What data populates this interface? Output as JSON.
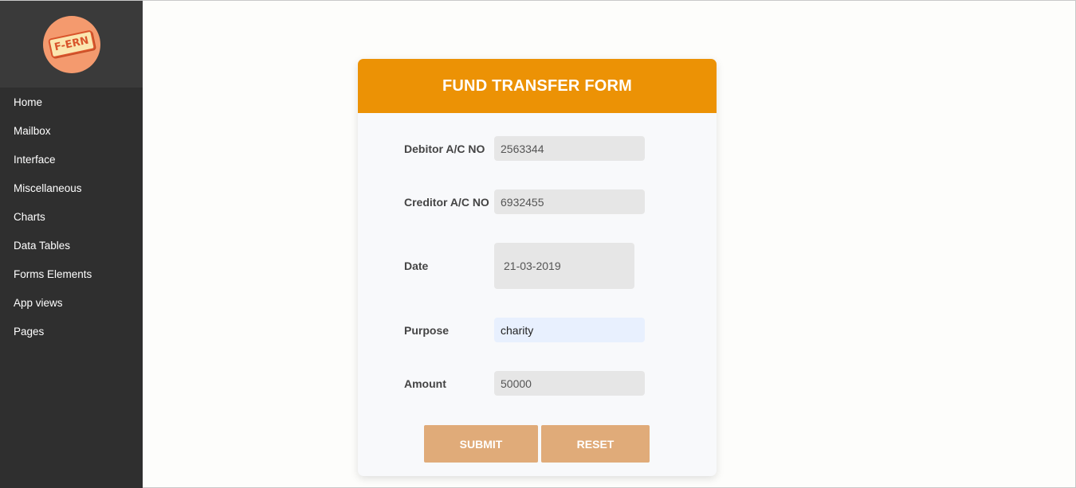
{
  "logo": {
    "text": "F-ERN"
  },
  "sidebar": {
    "items": [
      {
        "label": "Home"
      },
      {
        "label": "Mailbox"
      },
      {
        "label": "Interface"
      },
      {
        "label": "Miscellaneous"
      },
      {
        "label": "Charts"
      },
      {
        "label": "Data Tables"
      },
      {
        "label": "Forms Elements"
      },
      {
        "label": "App views"
      },
      {
        "label": "Pages"
      }
    ]
  },
  "form": {
    "title": "FUND TRANSFER FORM",
    "fields": {
      "debitor": {
        "label": "Debitor A/C NO",
        "value": "2563344"
      },
      "creditor": {
        "label": "Creditor A/C NO",
        "value": "6932455"
      },
      "date": {
        "label": "Date",
        "value": "21-03-2019"
      },
      "purpose": {
        "label": "Purpose",
        "value": "charity"
      },
      "amount": {
        "label": "Amount",
        "value": "50000"
      }
    },
    "submit_label": "SUBMIT",
    "reset_label": "RESET"
  },
  "colors": {
    "header": "#ec9205",
    "button": "#e0ab79",
    "sidebar": "#2f2f2f",
    "logo_circle": "#f49a6e"
  }
}
